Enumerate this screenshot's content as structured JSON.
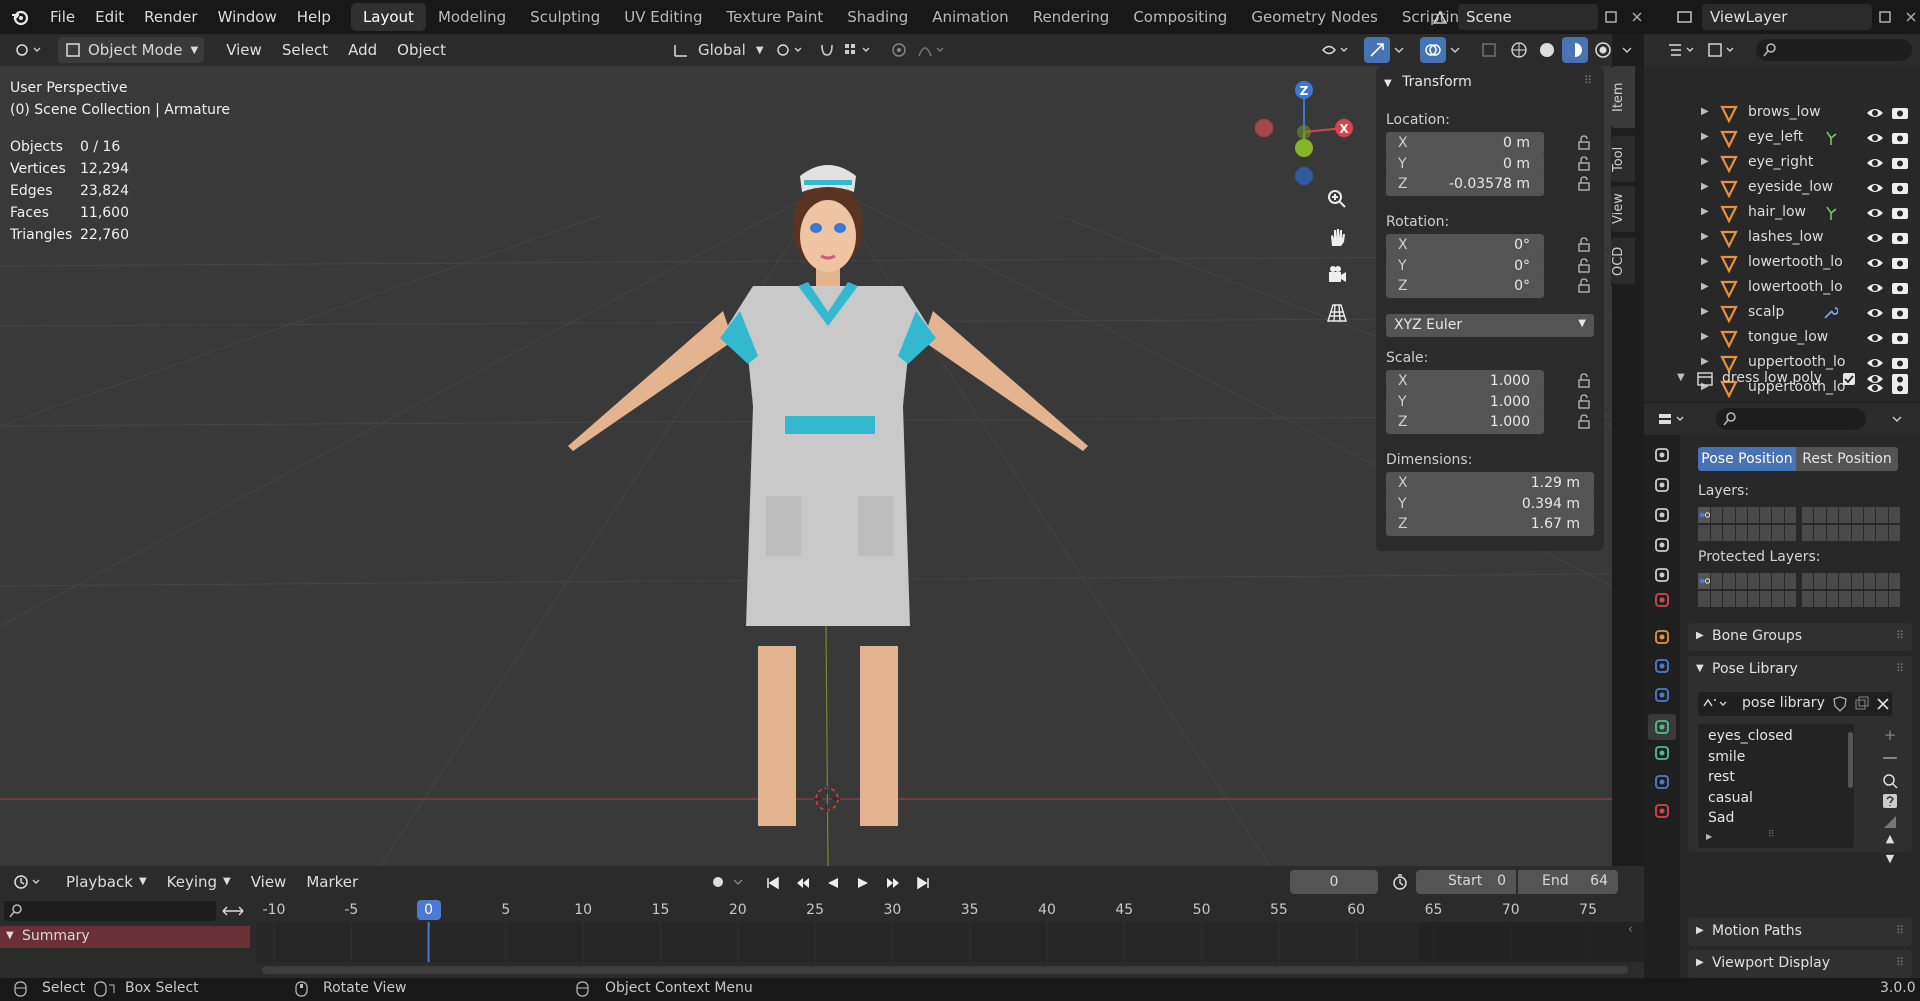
{
  "menu": {
    "items": [
      "File",
      "Edit",
      "Render",
      "Window",
      "Help"
    ],
    "workspaces": [
      "Layout",
      "Modeling",
      "Sculpting",
      "UV Editing",
      "Texture Paint",
      "Shading",
      "Animation",
      "Rendering",
      "Compositing",
      "Geometry Nodes",
      "Scripting"
    ],
    "active_workspace": "Layout",
    "add_workspace": "+",
    "scene": "Scene",
    "view_layer": "ViewLayer"
  },
  "header": {
    "mode": "Object Mode",
    "menus": [
      "View",
      "Select",
      "Add",
      "Object"
    ],
    "orientation": "Global"
  },
  "overlay": {
    "perspective": "User Perspective",
    "collection": "(0) Scene Collection | Armature",
    "stats": [
      {
        "label": "Objects",
        "value": "0 / 16"
      },
      {
        "label": "Vertices",
        "value": "12,294"
      },
      {
        "label": "Edges",
        "value": "23,824"
      },
      {
        "label": "Faces",
        "value": "11,600"
      },
      {
        "label": "Triangles",
        "value": "22,760"
      }
    ]
  },
  "gizmo": {
    "z": "Z",
    "x": "X"
  },
  "transform": {
    "title": "Transform",
    "location_label": "Location:",
    "location": [
      {
        "axis": "X",
        "value": "0 m"
      },
      {
        "axis": "Y",
        "value": "0 m"
      },
      {
        "axis": "Z",
        "value": "-0.03578 m"
      }
    ],
    "rotation_label": "Rotation:",
    "rotation": [
      {
        "axis": "X",
        "value": "0°"
      },
      {
        "axis": "Y",
        "value": "0°"
      },
      {
        "axis": "Z",
        "value": "0°"
      }
    ],
    "rotation_mode": "XYZ Euler",
    "scale_label": "Scale:",
    "scale": [
      {
        "axis": "X",
        "value": "1.000"
      },
      {
        "axis": "Y",
        "value": "1.000"
      },
      {
        "axis": "Z",
        "value": "1.000"
      }
    ],
    "dimensions_label": "Dimensions:",
    "dimensions": [
      {
        "axis": "X",
        "value": "1.29 m"
      },
      {
        "axis": "Y",
        "value": "0.394 m"
      },
      {
        "axis": "Z",
        "value": "1.67 m"
      }
    ]
  },
  "side_tabs": [
    "Item",
    "Tool",
    "View",
    "OCD"
  ],
  "outliner": {
    "rows": [
      "brows_low",
      "eye_left",
      "eye_right",
      "eyeside_low",
      "hair_low",
      "lashes_low",
      "lowertooth_lo",
      "lowertooth_lo",
      "scalp",
      "tongue_low",
      "uppertooth_lo",
      "uppertooth_lo"
    ],
    "collection": "dress low poly"
  },
  "properties": {
    "pose_position": "Pose Position",
    "rest_position": "Rest Position",
    "layers_label": "Layers:",
    "protected_layers_label": "Protected Layers:",
    "bone_groups": "Bone Groups",
    "pose_library": "Pose Library",
    "pose_library_name": "pose library",
    "poses": [
      "eyes_closed",
      "smile",
      "rest",
      "casual",
      "Sad"
    ],
    "motion_paths": "Motion Paths",
    "viewport_display": "Viewport Display"
  },
  "timeline": {
    "menus": [
      "Playback",
      "Keying",
      "View",
      "Marker"
    ],
    "current_frame": "0",
    "start_label": "Start",
    "start": "0",
    "end_label": "End",
    "end": "64",
    "ticks": [
      "-10",
      "-5",
      "0",
      "5",
      "10",
      "15",
      "20",
      "25",
      "30",
      "35",
      "40",
      "45",
      "50",
      "55",
      "60",
      "65",
      "70",
      "75"
    ],
    "summary": "Summary"
  },
  "status": {
    "select": "Select",
    "box_select": "Box Select",
    "rotate_view": "Rotate View",
    "context_menu": "Object Context Menu",
    "version": "3.0.0"
  },
  "colors": {
    "accent": "#4772b3",
    "timeline_accent": "#4b7bd1",
    "summary_bg": "#6b3036",
    "x_axis": "#d9434f",
    "z_axis": "#3d77d1",
    "y_axis": "#83b527"
  }
}
